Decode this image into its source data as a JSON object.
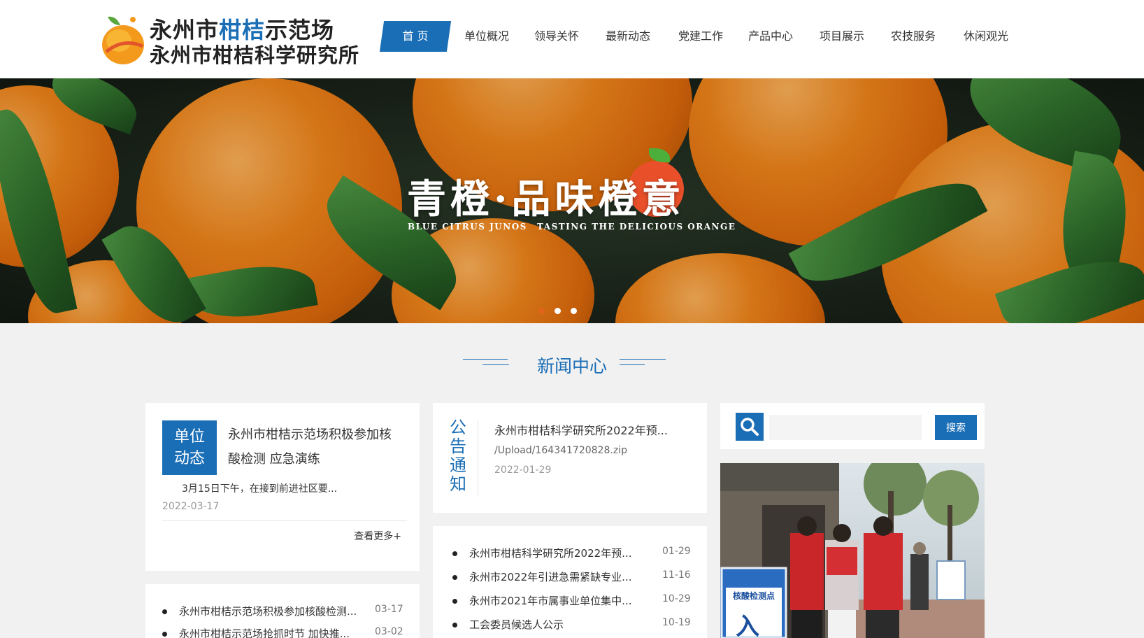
{
  "logo": {
    "line1_a": "永州市",
    "line1_b": "柑桔",
    "line1_c": "示范场",
    "line2": "永州市柑桔科学研究所"
  },
  "nav": {
    "items": [
      "首 页",
      "单位概况",
      "领导关怀",
      "最新动态",
      "党建工作",
      "产品中心",
      "项目展示",
      "农技服务",
      "休闲观光"
    ],
    "active_index": 0
  },
  "banner": {
    "slogan_cn": "青橙·品味橙意",
    "slogan_en_left": "BLUE CITRUS JUNOS",
    "slogan_en_right": "TASTING THE DELICIOUS ORANGE",
    "slide_count": 3,
    "active_slide": 0
  },
  "news_center": {
    "title": "新闻中心"
  },
  "unit_news": {
    "badge_line1": "单位",
    "badge_line2": "动态",
    "title": "永州市柑桔示范场积极参加核酸检测 应急演练",
    "summary": "3月15日下午，在接到前进社区要...",
    "date": "2022-03-17",
    "more": "查看更多+",
    "list": [
      {
        "text": "永州市柑桔示范场积极参加核酸检测...",
        "date": "03-17"
      },
      {
        "text": "永州市柑桔示范场抢抓时节 加快推...",
        "date": "03-02"
      }
    ]
  },
  "notice": {
    "label": [
      "公",
      "告",
      "通",
      "知"
    ],
    "title": "永州市柑桔科学研究所2022年预...",
    "file": "/Upload/164341720828.zip",
    "date": "2022-01-29",
    "list": [
      {
        "text": "永州市柑桔科学研究所2022年预...",
        "date": "01-29"
      },
      {
        "text": "永州市2022年引进急需紧缺专业...",
        "date": "11-16"
      },
      {
        "text": "永州市2021年市属事业单位集中...",
        "date": "10-29"
      },
      {
        "text": "工会委员候选人公示",
        "date": "10-19"
      }
    ]
  },
  "search": {
    "placeholder": "",
    "button": "搜索"
  },
  "photo": {
    "sign_text": "核酸检测点",
    "sign_arrow": "入"
  },
  "colors": {
    "brand_blue": "#1a6eb6",
    "accent_orange": "#e0651a"
  }
}
